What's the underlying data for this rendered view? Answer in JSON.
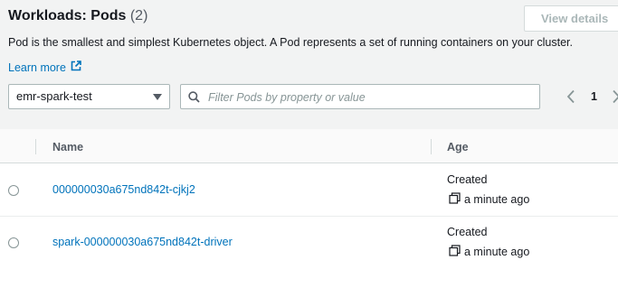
{
  "header": {
    "title": "Workloads: Pods",
    "count": "(2)",
    "view_details_label": "View details",
    "description": "Pod is the smallest and simplest Kubernetes object. A Pod represents a set of running containers on your cluster.",
    "learn_more_label": "Learn more",
    "learn_more_icon": "external-link-icon"
  },
  "filters": {
    "namespace_selected": "emr-spark-test",
    "search_placeholder": "Filter Pods by property or value",
    "search_value": ""
  },
  "pagination": {
    "current_page": "1"
  },
  "table": {
    "columns": [
      "Name",
      "Age"
    ],
    "rows": [
      {
        "name": "000000030a675nd842t-cjkj2",
        "age_label": "Created",
        "age_value": "a minute ago"
      },
      {
        "name": "spark-000000030a675nd842t-driver",
        "age_label": "Created",
        "age_value": "a minute ago"
      }
    ]
  },
  "colors": {
    "link": "#0073bb",
    "header_bg": "#f2f3f3",
    "border": "#d5dbdb"
  }
}
